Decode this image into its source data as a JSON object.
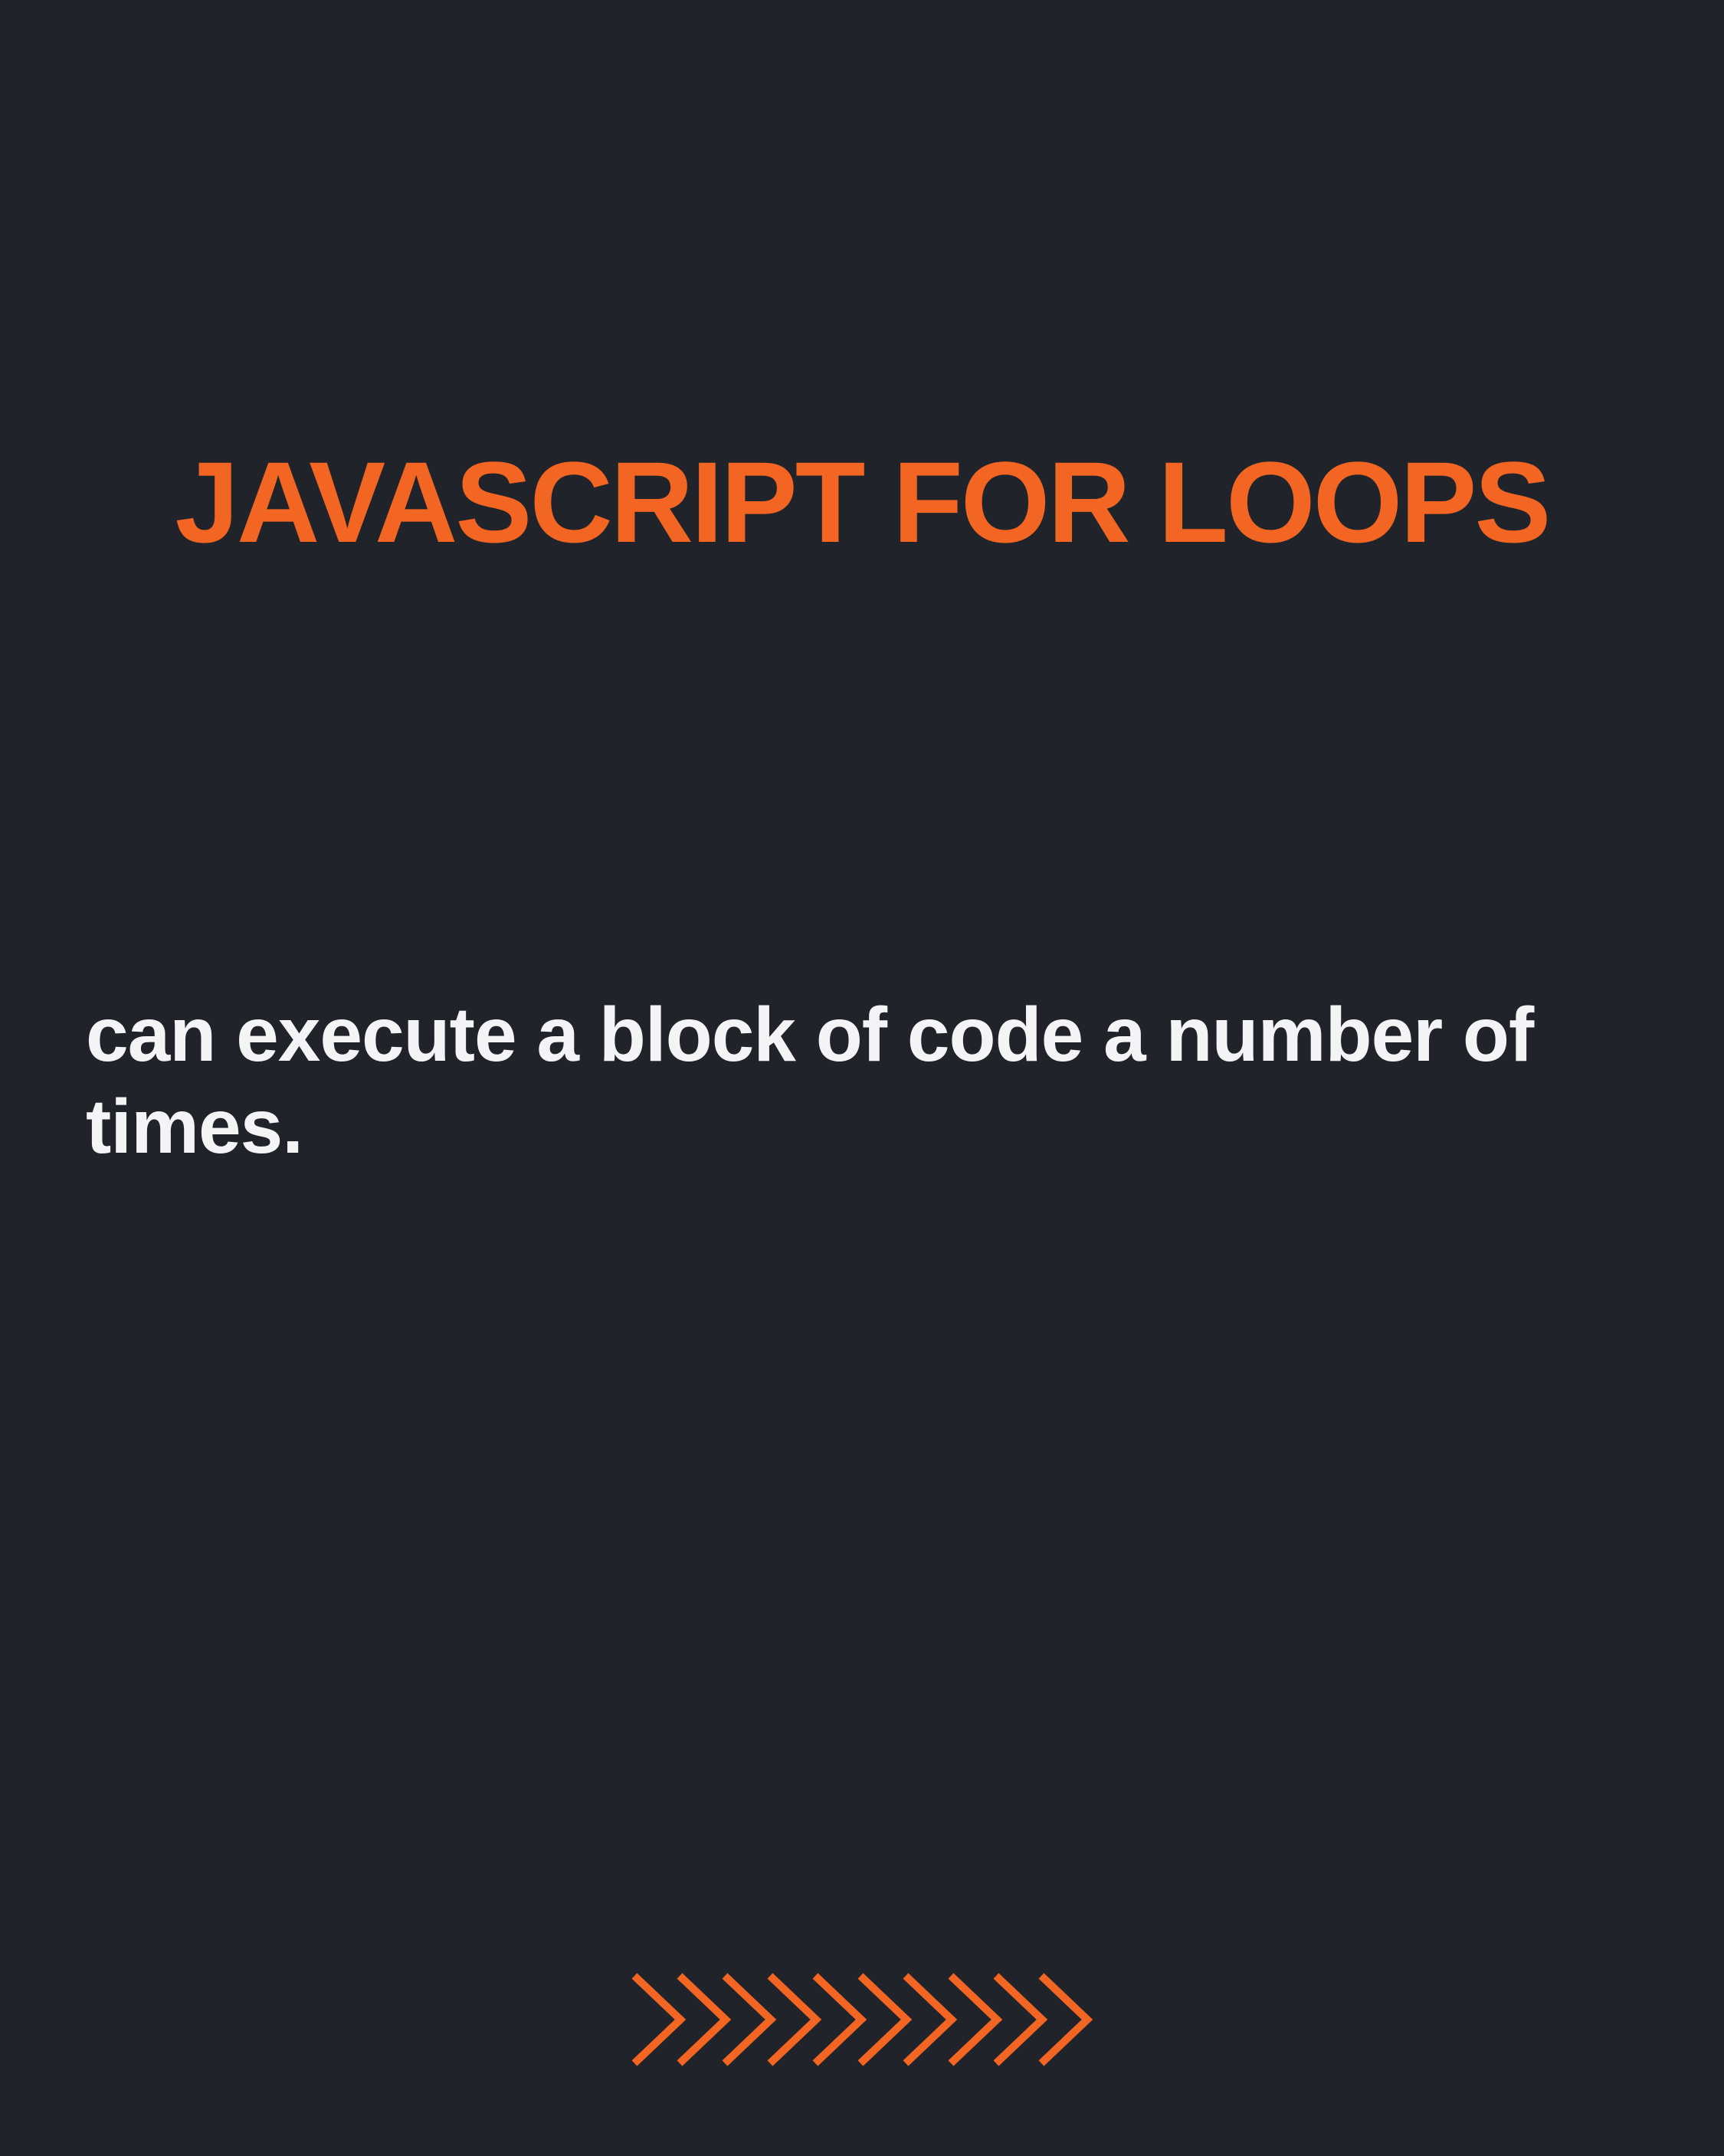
{
  "slide": {
    "title": "JAVASCRIPT FOR LOOPS",
    "description": "can execute a block of code a number of times."
  },
  "decoration": {
    "icon": "chevron-arrows-icon",
    "chevron_count": 10
  },
  "colors": {
    "background": "#20242a",
    "accent": "#f26522",
    "text": "#f4f4f6"
  }
}
